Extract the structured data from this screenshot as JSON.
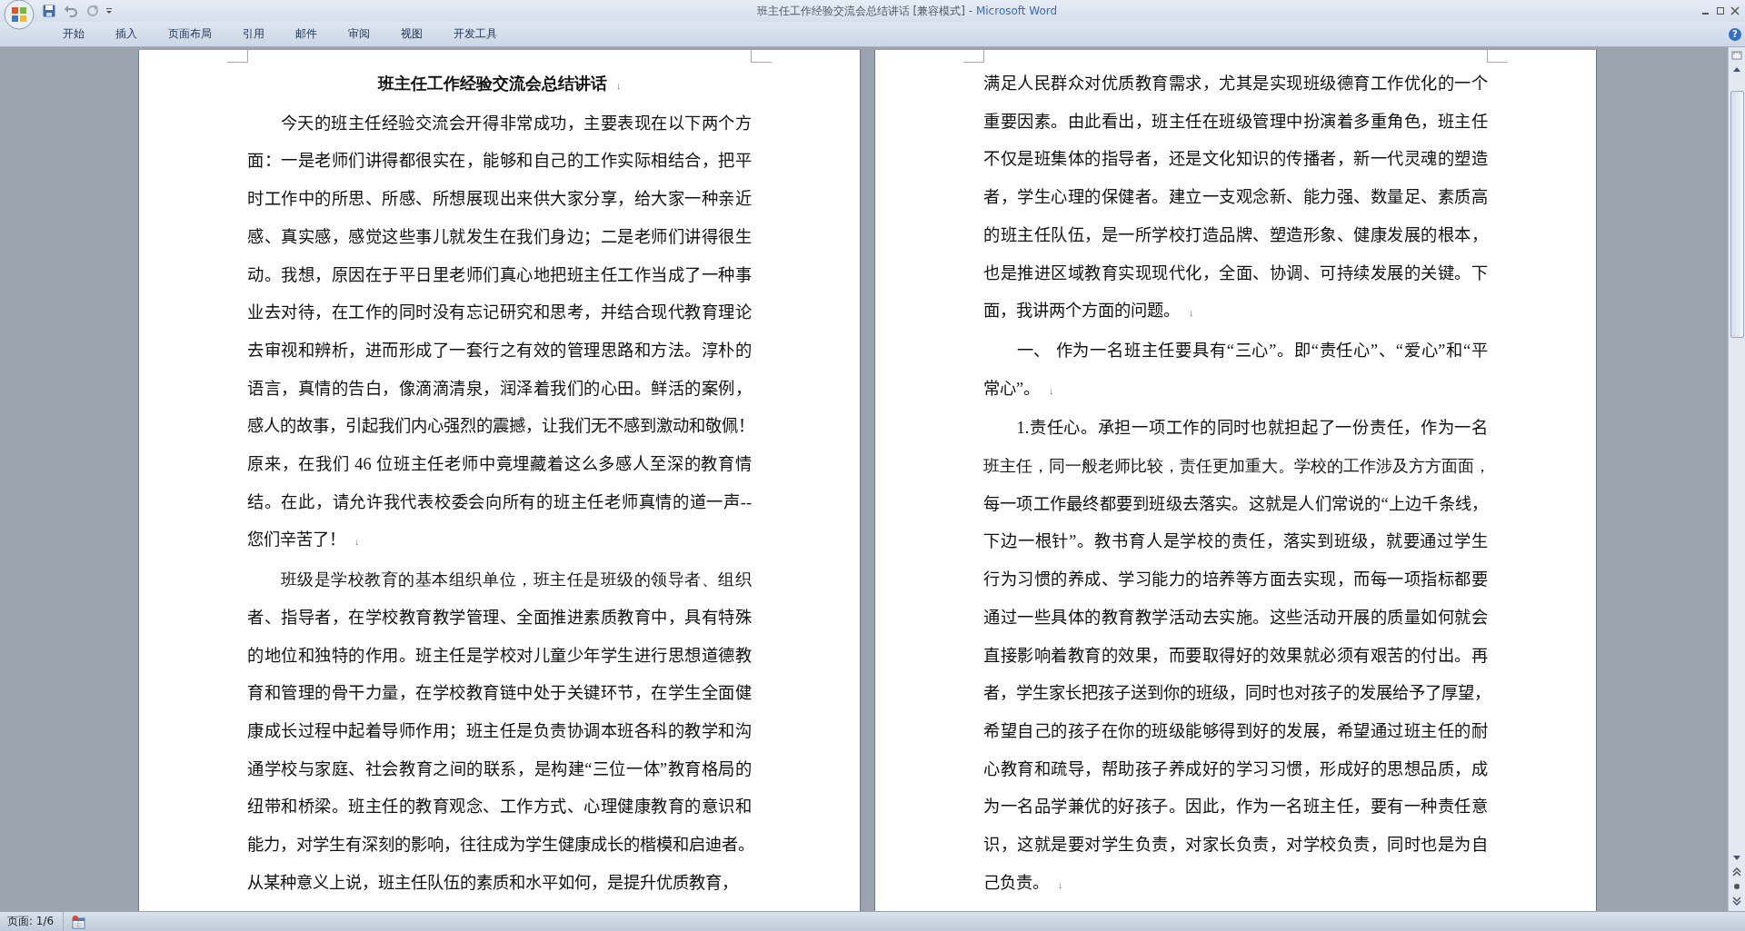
{
  "window": {
    "title": "班主任工作经验交流会总结讲话 [兼容模式] -",
    "app_name": "Microsoft Word"
  },
  "ribbon_tabs": [
    {
      "label": "开始",
      "selected": false
    },
    {
      "label": "插入",
      "selected": false
    },
    {
      "label": "页面布局",
      "selected": false
    },
    {
      "label": "引用",
      "selected": false
    },
    {
      "label": "邮件",
      "selected": false
    },
    {
      "label": "审阅",
      "selected": false
    },
    {
      "label": "视图",
      "selected": false
    },
    {
      "label": "开发工具",
      "selected": false
    }
  ],
  "help_button": "?",
  "pages": [
    {
      "paragraphs": [
        {
          "kind": "title",
          "indent": false,
          "end_mark": "↓",
          "lines": [
            "班主任工作经验交流会总结讲话"
          ]
        },
        {
          "kind": "body",
          "indent": true,
          "end_mark": "↓",
          "lines": [
            "今天的班主任经验交流会开得非常成功，主要表现在以下两个方",
            "面：一是老师们讲得都很实在，能够和自己的工作实际相结合，把平",
            "时工作中的所思、所感、所想展现出来供大家分享，给大家一种亲近",
            "感、真实感，感觉这些事儿就发生在我们身边；二是老师们讲得很生",
            "动。我想，原因在于平日里老师们真心地把班主任工作当成了一种事",
            "业去对待，在工作的同时没有忘记研究和思考，并结合现代教育理论",
            "去审视和辨析，进而形成了一套行之有效的管理思路和方法。淳朴的",
            "语言，真情的告白，像滴滴清泉，润泽着我们的心田。鲜活的案例，",
            "感人的故事，引起我们内心强烈的震撼，让我们无不感到激动和敬佩！",
            "原来，在我们 46 位班主任老师中竟埋藏着这么多感人至深的教育情",
            "结。在此，请允许我代表校委会向所有的班主任老师真情的道一声--",
            "您们辛苦了！"
          ]
        },
        {
          "kind": "body",
          "indent": true,
          "lines": [
            "班级是学校教育的基本组织单位，班主任是班级的领导者、组织",
            "者、指导者，在学校教育教学管理、全面推进素质教育中，具有特殊",
            "的地位和独特的作用。班主任是学校对儿童少年学生进行思想道德教",
            "育和管理的骨干力量，在学校教育链中处于关键环节，在学生全面健",
            "康成长过程中起着导师作用；班主任是负责协调本班各科的教学和沟",
            "通学校与家庭、社会教育之间的联系，是构建“三位一体”教育格局的",
            "纽带和桥梁。班主任的教育观念、工作方式、心理健康教育的意识和",
            "能力，对学生有深刻的影响，往往成为学生健康成长的楷模和启迪者。",
            "从某种意义上说，班主任队伍的素质和水平如何，是提升优质教育，"
          ]
        }
      ]
    },
    {
      "paragraphs": [
        {
          "kind": "body",
          "indent": false,
          "end_mark": "↓",
          "lines": [
            "满足人民群众对优质教育需求，尤其是实现班级德育工作优化的一个",
            "重要因素。由此看出，班主任在班级管理中扮演着多重角色，班主任",
            "不仅是班集体的指导者，还是文化知识的传播者，新一代灵魂的塑造",
            "者，学生心理的保健者。建立一支观念新、能力强、数量足、素质高",
            "的班主任队伍，是一所学校打造品牌、塑造形象、健康发展的根本，",
            "也是推进区域教育实现现代化，全面、协调、可持续发展的关键。下",
            "面，我讲两个方面的问题。"
          ]
        },
        {
          "kind": "body",
          "indent": true,
          "end_mark": "↓",
          "lines": [
            "一、 作为一名班主任要具有“三心”。即“责任心”、“爱心”和“平",
            "常心”。"
          ]
        },
        {
          "kind": "body",
          "indent": true,
          "end_mark": "↓",
          "lines": [
            "1.责任心。承担一项工作的同时也就担起了一份责任，作为一名",
            "班主任，同一般老师比较，责任更加重大。学校的工作涉及方方面面，",
            "每一项工作最终都要到班级去落实。这就是人们常说的“上边千条线，",
            "下边一根针”。教书育人是学校的责任，落实到班级，就要通过学生",
            "行为习惯的养成、学习能力的培养等方面去实现，而每一项指标都要",
            "通过一些具体的教育教学活动去实施。这些活动开展的质量如何就会",
            "直接影响着教育的效果，而要取得好的效果就必须有艰苦的付出。再",
            "者，学生家长把孩子送到你的班级，同时也对孩子的发展给予了厚望，",
            "希望自己的孩子在你的班级能够得到好的发展，希望通过班主任的耐",
            "心教育和疏导，帮助孩子养成好的学习习惯，形成好的思想品质，成",
            "为一名品学兼优的好孩子。因此，作为一名班主任，要有一种责任意",
            "识，这就是要对学生负责，对家长负责，对学校负责，同时也是为自",
            "己负责。"
          ]
        }
      ]
    }
  ],
  "status_bar": {
    "page": "页面: 1/6"
  }
}
